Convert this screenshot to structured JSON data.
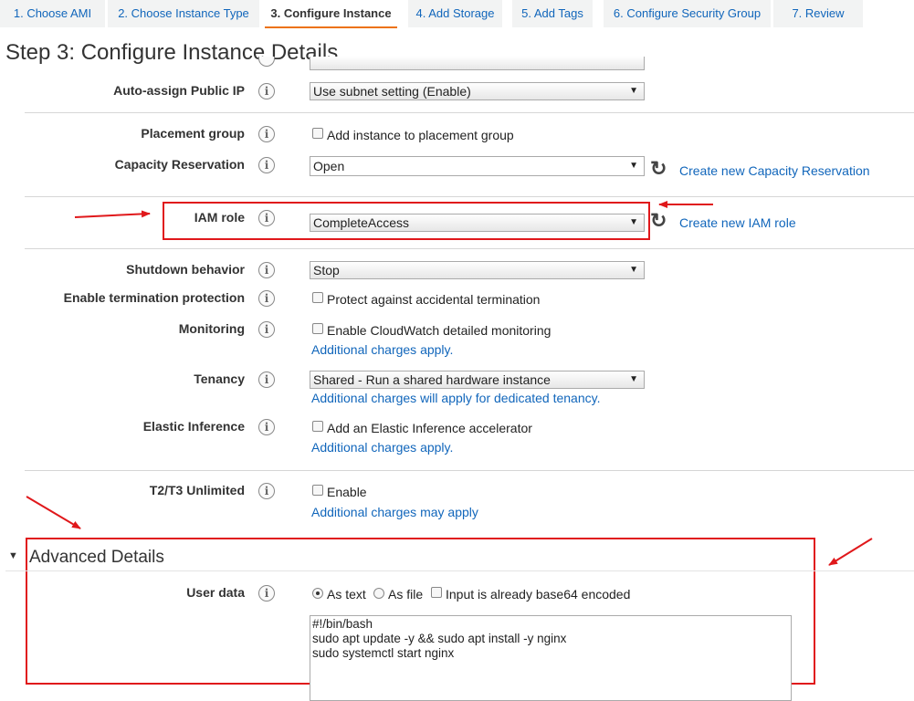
{
  "tabs": [
    {
      "label": "1. Choose AMI"
    },
    {
      "label": "2. Choose Instance Type"
    },
    {
      "label": "3. Configure Instance"
    },
    {
      "label": "4. Add Storage"
    },
    {
      "label": "5. Add Tags"
    },
    {
      "label": "6. Configure Security Group"
    },
    {
      "label": "7. Review"
    }
  ],
  "page_title": "Step 3: Configure Instance Details",
  "rows": {
    "auto_assign": {
      "label": "Auto-assign Public IP",
      "value": "Use subnet setting (Enable)"
    },
    "placement": {
      "label": "Placement group",
      "checkbox": "Add instance to placement group"
    },
    "capacity": {
      "label": "Capacity Reservation",
      "value": "Open",
      "link": "Create new Capacity Reservation"
    },
    "iam": {
      "label": "IAM role",
      "value": "CompleteAccess",
      "link": "Create new IAM role"
    },
    "shutdown": {
      "label": "Shutdown behavior",
      "value": "Stop"
    },
    "termination": {
      "label": "Enable termination protection",
      "checkbox": "Protect against accidental termination"
    },
    "monitoring": {
      "label": "Monitoring",
      "checkbox": "Enable CloudWatch detailed monitoring",
      "note": "Additional charges apply."
    },
    "tenancy": {
      "label": "Tenancy",
      "value": "Shared - Run a shared hardware instance",
      "note": "Additional charges will apply for dedicated tenancy."
    },
    "inference": {
      "label": "Elastic Inference",
      "checkbox": "Add an Elastic Inference accelerator",
      "note": "Additional charges apply."
    },
    "unlimited": {
      "label": "T2/T3 Unlimited",
      "checkbox": "Enable",
      "note": "Additional charges may apply"
    }
  },
  "advanced": {
    "title": "Advanced Details",
    "user_data_label": "User data",
    "as_text": "As text",
    "as_file": "As file",
    "base64": "Input is already base64 encoded",
    "script": "#!/bin/bash\nsudo apt update -y && sudo apt install -y nginx\nsudo systemctl start nginx"
  },
  "info_glyph": "i",
  "caret_glyph": "▼",
  "refresh_glyph": "↻",
  "colors": {
    "link": "#1166bb",
    "annotation_red": "#e0181b",
    "tab_active_underline": "#ec7211"
  }
}
